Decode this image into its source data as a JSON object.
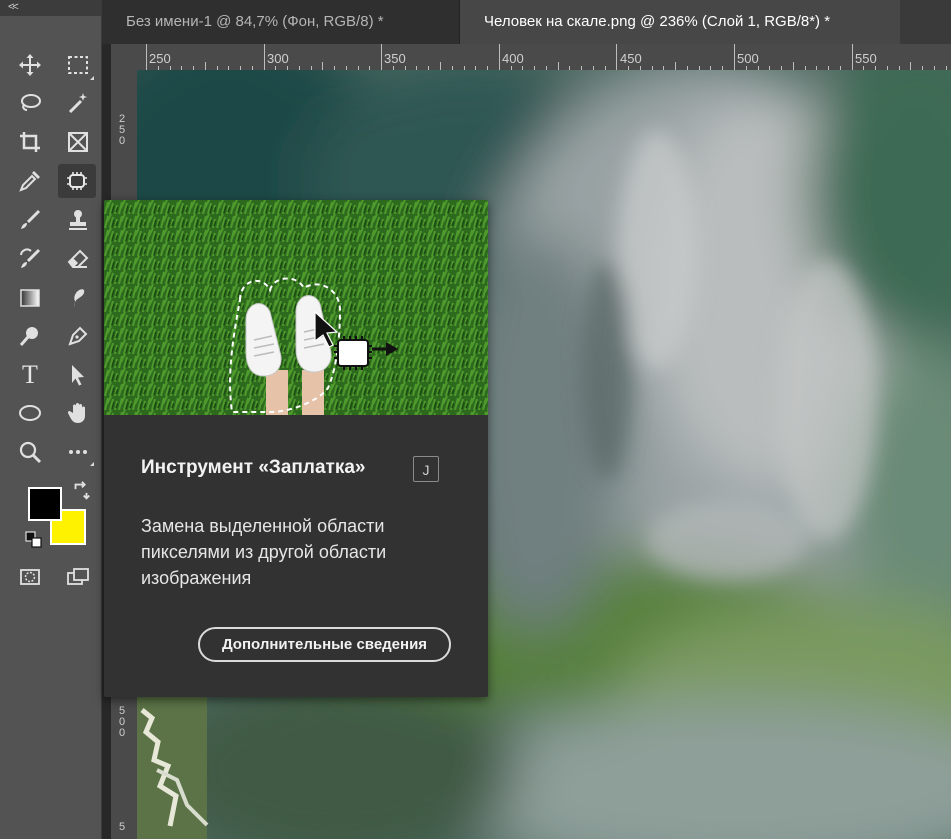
{
  "toolbar": {
    "collapse_label": "<<",
    "tools": [
      {
        "name": "move-tool",
        "icon": "move-icon"
      },
      {
        "name": "marquee-tool",
        "icon": "rect-marquee-icon"
      },
      {
        "name": "lasso-tool",
        "icon": "lasso-icon"
      },
      {
        "name": "magic-wand-tool",
        "icon": "magic-wand-icon"
      },
      {
        "name": "crop-tool",
        "icon": "crop-icon"
      },
      {
        "name": "frame-tool",
        "icon": "frame-icon"
      },
      {
        "name": "eyedropper-tool",
        "icon": "eyedropper-icon"
      },
      {
        "name": "patch-tool",
        "icon": "patch-icon"
      },
      {
        "name": "brush-tool",
        "icon": "brush-icon"
      },
      {
        "name": "stamp-tool",
        "icon": "stamp-icon"
      },
      {
        "name": "history-brush-tool",
        "icon": "history-brush-icon"
      },
      {
        "name": "eraser-tool",
        "icon": "eraser-icon"
      },
      {
        "name": "gradient-tool",
        "icon": "gradient-icon"
      },
      {
        "name": "smudge-tool",
        "icon": "smudge-icon"
      },
      {
        "name": "dodge-tool",
        "icon": "dodge-icon"
      },
      {
        "name": "pen-tool",
        "icon": "pen-icon"
      },
      {
        "name": "type-tool",
        "icon": "type-icon"
      },
      {
        "name": "path-select-tool",
        "icon": "arrow-icon"
      },
      {
        "name": "ellipse-tool",
        "icon": "ellipse-icon"
      },
      {
        "name": "hand-tool",
        "icon": "hand-icon"
      },
      {
        "name": "zoom-tool",
        "icon": "zoom-icon"
      },
      {
        "name": "more-tools",
        "icon": "ellipsis-icon"
      }
    ],
    "type_glyph": "T",
    "foreground_color": "#000000",
    "background_color": "#fff200"
  },
  "tabs": [
    {
      "label": "Без имени-1 @ 84,7% (Фон, RGB/8) *",
      "active": false
    },
    {
      "label": "Человек на скале.png @ 236% (Слой 1, RGB/8*) *",
      "active": true
    }
  ],
  "ruler": {
    "horizontal": [
      "250",
      "300",
      "350",
      "400",
      "450",
      "500",
      "550"
    ],
    "vertical": [
      "250",
      "500",
      "5"
    ]
  },
  "tooltip": {
    "title": "Инструмент «Заплатка»",
    "shortcut": "J",
    "description": "Замена выделенной области пикселями из другой области изображения",
    "learn_more": "Дополнительные сведения"
  }
}
